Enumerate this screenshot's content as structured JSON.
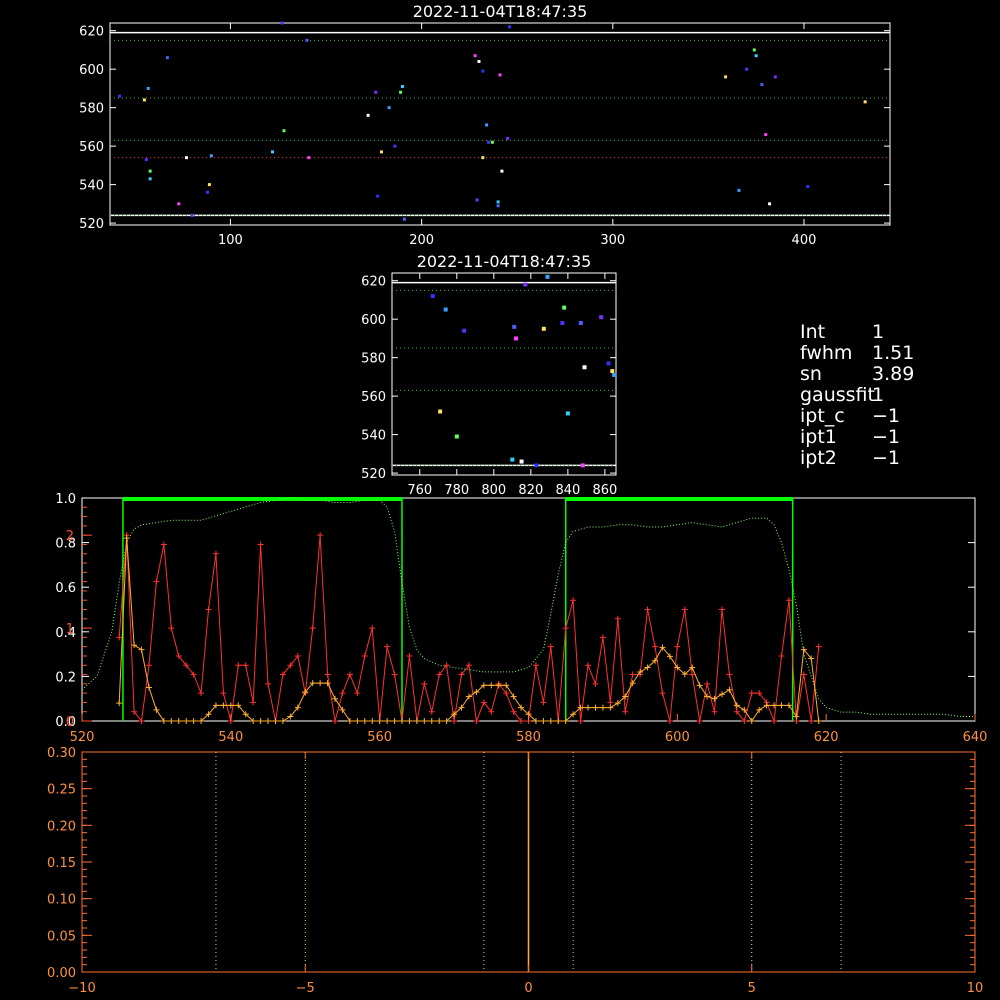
{
  "panel1": {
    "title": "2022-11-04T18:47:35",
    "xlim": [
      37,
      445
    ],
    "ylim": [
      519,
      624
    ],
    "xticks": [
      100,
      200,
      300,
      400
    ],
    "yticks": [
      520,
      540,
      560,
      580,
      600,
      620
    ],
    "white_lines": [
      524,
      619
    ],
    "green_lines": [
      524,
      563,
      585,
      615
    ],
    "red_lines": [
      554
    ],
    "points": [
      [
        42,
        586
      ],
      [
        55,
        584
      ],
      [
        57,
        590
      ],
      [
        56,
        553
      ],
      [
        58,
        547
      ],
      [
        58,
        543
      ],
      [
        67,
        606
      ],
      [
        73,
        530
      ],
      [
        77,
        554
      ],
      [
        80,
        524
      ],
      [
        88,
        536
      ],
      [
        89,
        540
      ],
      [
        90,
        555
      ],
      [
        127,
        624
      ],
      [
        128,
        568
      ],
      [
        122,
        557
      ],
      [
        140,
        615
      ],
      [
        141,
        554
      ],
      [
        172,
        576
      ],
      [
        176,
        588
      ],
      [
        177,
        534
      ],
      [
        179,
        557
      ],
      [
        183,
        580
      ],
      [
        186,
        560
      ],
      [
        189,
        588
      ],
      [
        190,
        591
      ],
      [
        191,
        522
      ],
      [
        228,
        607
      ],
      [
        230,
        604
      ],
      [
        229,
        532
      ],
      [
        232,
        599
      ],
      [
        232,
        554
      ],
      [
        234,
        571
      ],
      [
        235,
        562
      ],
      [
        237,
        562
      ],
      [
        240,
        531
      ],
      [
        240,
        529
      ],
      [
        241,
        597
      ],
      [
        242,
        547
      ],
      [
        245,
        564
      ],
      [
        246,
        622
      ],
      [
        359,
        596
      ],
      [
        366,
        537
      ],
      [
        370,
        600
      ],
      [
        374,
        610
      ],
      [
        375,
        607
      ],
      [
        378,
        592
      ],
      [
        380,
        566
      ],
      [
        382,
        530
      ],
      [
        385,
        596
      ],
      [
        402,
        539
      ],
      [
        432,
        583
      ]
    ]
  },
  "panel2": {
    "title": "2022-11-04T18:47:35",
    "xlim": [
      745,
      866
    ],
    "ylim": [
      519,
      624
    ],
    "xticks": [
      760,
      780,
      800,
      820,
      840,
      860
    ],
    "yticks": [
      520,
      540,
      560,
      580,
      600,
      620
    ],
    "white_lines": [
      524,
      619
    ],
    "green_lines": [
      524,
      563,
      585,
      615
    ],
    "points": [
      [
        767,
        612
      ],
      [
        771,
        552
      ],
      [
        774,
        605
      ],
      [
        784,
        594
      ],
      [
        780,
        539
      ],
      [
        810,
        527
      ],
      [
        811,
        596
      ],
      [
        812,
        590
      ],
      [
        815,
        526
      ],
      [
        817,
        618
      ],
      [
        823,
        524
      ],
      [
        827,
        595
      ],
      [
        829,
        622
      ],
      [
        837,
        598
      ],
      [
        838,
        606
      ],
      [
        840,
        551
      ],
      [
        847,
        598
      ],
      [
        848,
        524
      ],
      [
        849,
        575
      ],
      [
        858,
        601
      ],
      [
        862,
        577
      ],
      [
        864,
        573
      ],
      [
        865,
        571
      ]
    ]
  },
  "stats": [
    {
      "key": "Int",
      "value": "1"
    },
    {
      "key": "fwhm",
      "value": "1.51"
    },
    {
      "key": "sn",
      "value": "3.89"
    },
    {
      "key": "gaussfit",
      "value": "1"
    },
    {
      "key": "ipt_c",
      "value": "−1"
    },
    {
      "key": "ipt1",
      "value": "−1"
    },
    {
      "key": "ipt2",
      "value": "−1"
    }
  ],
  "chart_data": [
    {
      "type": "line",
      "xlim": [
        520,
        640
      ],
      "xticks": [
        520,
        540,
        560,
        580,
        600,
        620,
        640
      ],
      "yaxis_white": {
        "ylim": [
          0,
          1.0
        ],
        "ticks": [
          "0.0",
          "0.2",
          "0.4",
          "0.6",
          "0.8",
          "1.0"
        ]
      },
      "yaxis_red": {
        "ylim": [
          0,
          2.4
        ],
        "ticks": [
          "0",
          "1",
          "2"
        ]
      },
      "green_windows": [
        [
          525.5,
          563
        ],
        [
          585,
          615.5
        ]
      ],
      "green_dotted_profile": {
        "x": [
          520,
          522,
          524,
          525,
          526,
          527,
          528,
          530,
          532,
          534,
          536,
          538,
          540,
          542,
          544,
          546,
          548,
          550,
          552,
          554,
          556,
          558,
          560,
          561,
          562,
          563,
          564,
          565,
          566,
          568,
          570,
          572,
          574,
          576,
          578,
          580,
          582,
          583,
          584,
          585,
          586,
          588,
          590,
          592,
          594,
          596,
          598,
          600,
          602,
          604,
          606,
          608,
          610,
          612,
          613,
          614,
          615,
          616,
          617,
          618,
          619,
          620,
          622,
          624,
          626,
          628,
          630,
          632,
          634,
          636,
          638,
          640
        ],
        "y": [
          0.14,
          0.2,
          0.4,
          0.62,
          0.8,
          0.86,
          0.88,
          0.89,
          0.9,
          0.9,
          0.9,
          0.92,
          0.94,
          0.96,
          0.98,
          0.99,
          1.0,
          0.99,
          0.99,
          0.98,
          0.98,
          0.99,
          0.99,
          0.96,
          0.85,
          0.62,
          0.42,
          0.32,
          0.28,
          0.25,
          0.24,
          0.23,
          0.22,
          0.22,
          0.22,
          0.24,
          0.32,
          0.48,
          0.66,
          0.8,
          0.85,
          0.87,
          0.87,
          0.88,
          0.88,
          0.87,
          0.87,
          0.88,
          0.89,
          0.88,
          0.87,
          0.89,
          0.91,
          0.91,
          0.88,
          0.8,
          0.68,
          0.52,
          0.3,
          0.2,
          0.1,
          0.06,
          0.04,
          0.04,
          0.03,
          0.03,
          0.03,
          0.03,
          0.03,
          0.03,
          0.02,
          0.02
        ]
      },
      "series": [
        {
          "color": "#ff3030",
          "x": [
            525,
            526,
            527,
            528,
            529,
            530,
            531,
            532,
            533,
            534,
            535,
            536,
            537,
            538,
            539,
            540,
            541,
            542,
            543,
            544,
            545,
            546,
            547,
            548,
            549,
            550,
            551,
            552,
            553,
            554,
            555,
            556,
            557,
            558,
            559,
            560,
            561,
            562,
            563,
            564,
            565,
            566,
            567,
            568,
            569,
            570,
            571,
            572,
            573,
            574,
            575,
            576,
            577,
            578,
            579,
            580,
            581,
            582,
            583,
            584,
            585,
            586,
            587,
            588,
            589,
            590,
            591,
            592,
            593,
            594,
            595,
            596,
            597,
            598,
            599,
            600,
            601,
            602,
            603,
            604,
            605,
            606,
            607,
            608,
            609,
            610,
            611,
            612,
            613,
            614,
            615,
            616,
            617,
            618,
            619
          ],
          "y": [
            0.9,
            2.0,
            0.1,
            0.0,
            0.6,
            1.5,
            1.9,
            1.0,
            0.7,
            0.6,
            0.5,
            0.3,
            1.2,
            1.8,
            0.3,
            0.0,
            0.6,
            0.6,
            0.2,
            1.9,
            0.4,
            0.0,
            0.5,
            0.6,
            0.7,
            0.3,
            1.0,
            2.0,
            0.5,
            0.0,
            0.3,
            0.5,
            0.3,
            0.7,
            1.0,
            0.0,
            0.8,
            0.5,
            0.0,
            0.7,
            0.0,
            0.4,
            0.1,
            0.5,
            0.6,
            0.0,
            0.5,
            0.6,
            0.0,
            0.2,
            0.1,
            0.4,
            0.3,
            0.1,
            0.0,
            0.0,
            0.6,
            0.2,
            0.8,
            0.0,
            1.0,
            1.3,
            0.0,
            0.6,
            0.4,
            0.9,
            0.2,
            1.1,
            0.1,
            0.5,
            0.5,
            1.2,
            0.8,
            0.3,
            0.0,
            0.8,
            1.2,
            0.5,
            0.0,
            0.4,
            0.1,
            1.2,
            0.5,
            0.1,
            0.0,
            0.3,
            0.3,
            0.2,
            0.0,
            0.7,
            1.3,
            0.0,
            0.5,
            0.0,
            0.8
          ]
        },
        {
          "color": "#ffb030",
          "x": [
            525,
            526,
            527,
            528,
            529,
            530,
            531,
            532,
            533,
            534,
            535,
            536,
            537,
            538,
            539,
            540,
            541,
            542,
            543,
            544,
            545,
            546,
            547,
            548,
            549,
            550,
            551,
            552,
            553,
            554,
            555,
            556,
            557,
            558,
            559,
            560,
            561,
            562,
            563,
            564,
            565,
            566,
            567,
            568,
            569,
            570,
            571,
            572,
            573,
            574,
            575,
            576,
            577,
            578,
            579,
            580,
            581,
            582,
            583,
            584,
            585,
            586,
            587,
            588,
            589,
            590,
            591,
            592,
            593,
            594,
            595,
            596,
            597,
            598,
            599,
            600,
            601,
            602,
            603,
            604,
            605,
            606,
            607,
            608,
            609,
            610,
            611,
            612,
            613,
            614,
            615,
            616,
            617,
            618,
            619
          ],
          "y": [
            0.08,
            0.82,
            0.34,
            0.32,
            0.15,
            0.05,
            0.0,
            0.0,
            0.0,
            0.0,
            0.0,
            0.0,
            0.03,
            0.07,
            0.07,
            0.07,
            0.07,
            0.03,
            0.0,
            0.0,
            0.0,
            0.0,
            0.0,
            0.02,
            0.06,
            0.13,
            0.17,
            0.17,
            0.17,
            0.1,
            0.05,
            0.0,
            0.0,
            0.0,
            0.0,
            0.0,
            0.0,
            0.0,
            0.0,
            0.0,
            0.0,
            0.0,
            0.0,
            0.0,
            0.0,
            0.03,
            0.06,
            0.11,
            0.13,
            0.16,
            0.16,
            0.16,
            0.16,
            0.11,
            0.06,
            0.03,
            0.0,
            0.0,
            0.0,
            0.0,
            0.0,
            0.03,
            0.06,
            0.06,
            0.06,
            0.06,
            0.06,
            0.08,
            0.11,
            0.17,
            0.22,
            0.24,
            0.27,
            0.33,
            0.29,
            0.24,
            0.21,
            0.24,
            0.16,
            0.11,
            0.1,
            0.12,
            0.14,
            0.07,
            0.05,
            0.0,
            0.05,
            0.07,
            0.07,
            0.07,
            0.07,
            0.02,
            0.32,
            0.28,
            0.0
          ]
        }
      ]
    },
    {
      "type": "line",
      "xlim": [
        -10,
        10
      ],
      "ylim": [
        0,
        0.3
      ],
      "xticks": [
        -10,
        -5,
        0,
        5,
        10
      ],
      "yticks": [
        "0.00",
        "0.05",
        "0.10",
        "0.15",
        "0.20",
        "0.25",
        "0.30"
      ],
      "dotted_vlines": [
        -7,
        -5,
        -1,
        1,
        5,
        7
      ],
      "solid_vline": 0
    }
  ]
}
